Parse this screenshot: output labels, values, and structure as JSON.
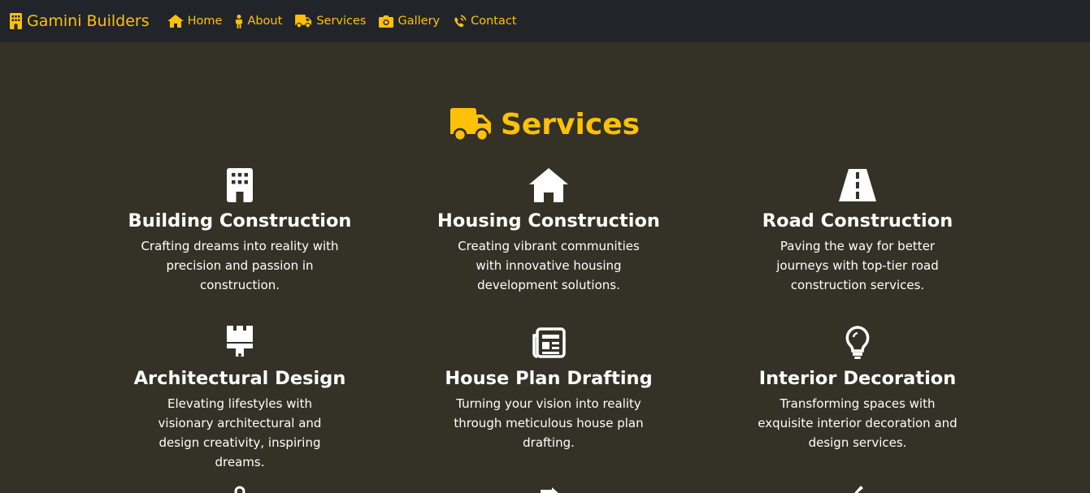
{
  "navbar": {
    "brand": "Gamini Builders",
    "brand_icon": "building-icon",
    "links": [
      {
        "label": "Home",
        "icon": "home-icon"
      },
      {
        "label": "About",
        "icon": "person-icon"
      },
      {
        "label": "Services",
        "icon": "truck-icon"
      },
      {
        "label": "Gallery",
        "icon": "camera-icon"
      },
      {
        "label": "Contact",
        "icon": "phone-volume-icon"
      }
    ]
  },
  "services": {
    "title": "Services",
    "title_icon": "truck-icon",
    "items": [
      {
        "icon": "building-icon",
        "title": "Building Construction",
        "text": "Crafting dreams into reality with precision and passion in construction."
      },
      {
        "icon": "house-icon",
        "title": "Housing Construction",
        "text": "Creating vibrant communities with innovative housing development solutions."
      },
      {
        "icon": "road-icon",
        "title": "Road Construction",
        "text": "Paving the way for better journeys with top-tier road construction services."
      },
      {
        "icon": "paintbrush-icon",
        "title": "Architectural Design",
        "text": "Elevating lifestyles with visionary architectural and design creativity, inspiring dreams."
      },
      {
        "icon": "newspaper-icon",
        "title": "House Plan Drafting",
        "text": "Turning your vision into reality through meticulous house plan drafting."
      },
      {
        "icon": "lightbulb-icon",
        "title": "Interior Decoration",
        "text": "Transforming spaces with exquisite interior decoration and design services."
      }
    ]
  },
  "colors": {
    "accent": "#ffc107",
    "navbar_bg": "#212529",
    "page_bg": "#343226",
    "text": "#ffffff"
  }
}
